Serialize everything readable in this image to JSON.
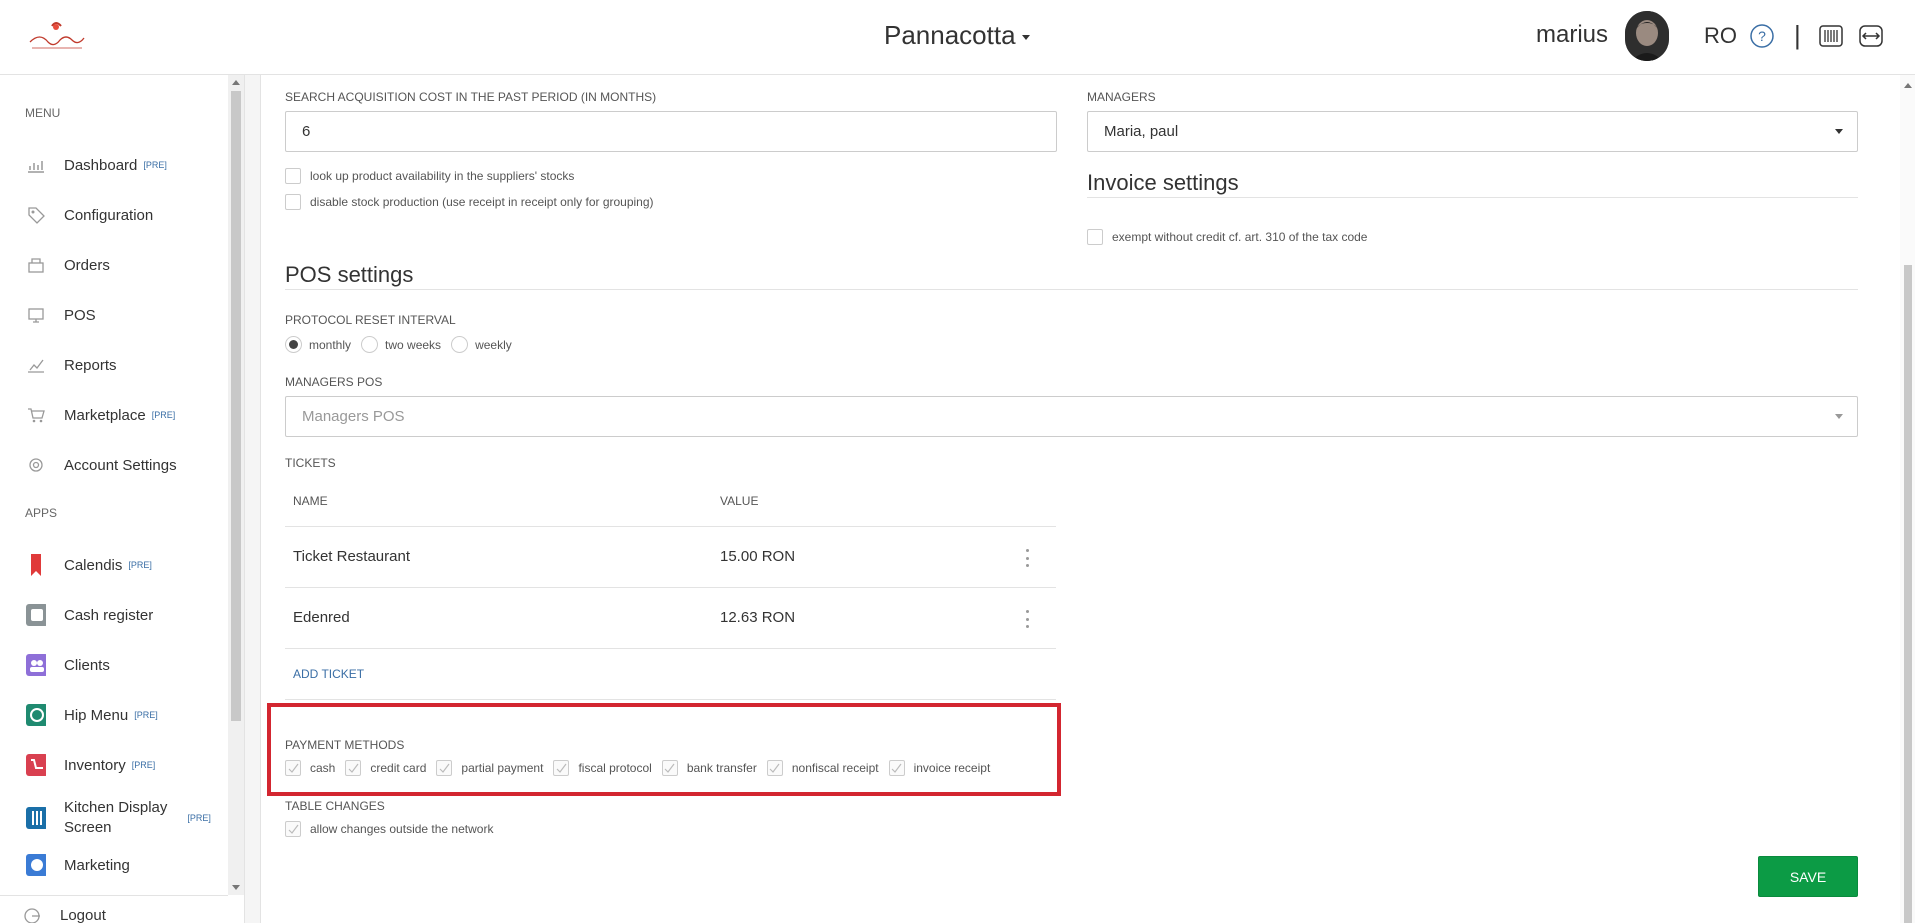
{
  "header": {
    "company": "Pannacotta",
    "username": "marius",
    "language": "RO",
    "separator": "|"
  },
  "sidebar": {
    "menu_heading": "MENU",
    "apps_heading": "APPS",
    "pre_badge": "[PRE]",
    "menu_items": [
      {
        "label": "Dashboard",
        "icon": "dashboard-icon",
        "pre": true
      },
      {
        "label": "Configuration",
        "icon": "tag-icon",
        "pre": false
      },
      {
        "label": "Orders",
        "icon": "orders-icon",
        "pre": false
      },
      {
        "label": "POS",
        "icon": "pos-icon",
        "pre": false
      },
      {
        "label": "Reports",
        "icon": "reports-icon",
        "pre": false
      },
      {
        "label": "Marketplace",
        "icon": "cart-icon",
        "pre": true
      },
      {
        "label": "Account Settings",
        "icon": "gear-icon",
        "pre": false
      }
    ],
    "app_items": [
      {
        "label": "Calendis",
        "icon": "calendis-icon",
        "pre": true,
        "color": "#e03a3a"
      },
      {
        "label": "Cash register",
        "icon": "cash-register-icon",
        "pre": false,
        "color": "#7f8c8d"
      },
      {
        "label": "Clients",
        "icon": "clients-icon",
        "pre": false,
        "color": "#8e6fd8"
      },
      {
        "label": "Hip Menu",
        "icon": "hip-menu-icon",
        "pre": true,
        "color": "#1f8a70"
      },
      {
        "label": "Inventory",
        "icon": "inventory-icon",
        "pre": true,
        "color": "#d94050"
      },
      {
        "label": "Kitchen Display Screen",
        "line1": "Kitchen Display",
        "line2": "Screen",
        "icon": "kitchen-display-icon",
        "pre": true,
        "color": "#1a6fa8"
      },
      {
        "label": "Marketing",
        "icon": "marketing-icon",
        "pre": false,
        "color": "#3a7bd5"
      }
    ],
    "logout": "Logout"
  },
  "acquisition": {
    "label": "SEARCH ACQUISITION COST IN THE PAST PERIOD (IN MONTHS)",
    "value": "6",
    "check_suppliers": "look up product availability in the suppliers' stocks",
    "check_disable_stock": "disable stock production (use receipt in receipt only for grouping)"
  },
  "managers": {
    "label": "MANAGERS",
    "value": "Maria, paul"
  },
  "invoice": {
    "title": "Invoice settings",
    "exempt": "exempt without credit cf. art. 310 of the tax code"
  },
  "pos": {
    "title": "POS settings",
    "reset_label": "PROTOCOL RESET INTERVAL",
    "reset_options": [
      "monthly",
      "two weeks",
      "weekly"
    ],
    "reset_selected": "monthly",
    "managers_pos_label": "MANAGERS POS",
    "managers_pos_placeholder": "Managers POS",
    "tickets_label": "TICKETS",
    "col_name": "NAME",
    "col_value": "VALUE",
    "tickets": [
      {
        "name": "Ticket Restaurant",
        "value": "15.00 RON"
      },
      {
        "name": "Edenred",
        "value": "12.63 RON"
      }
    ],
    "add_ticket": "ADD TICKET",
    "payment_label": "PAYMENT METHODS",
    "payment_methods": [
      "cash",
      "credit card",
      "partial payment",
      "fiscal protocol",
      "bank transfer",
      "nonfiscal receipt",
      "invoice receipt"
    ],
    "table_changes_label": "TABLE CHANGES",
    "table_changes_option": "allow changes outside the network"
  },
  "save_label": "SAVE",
  "colors": {
    "accent": "#3a6ea5",
    "save": "#0c9b45",
    "highlight": "#d32630"
  }
}
